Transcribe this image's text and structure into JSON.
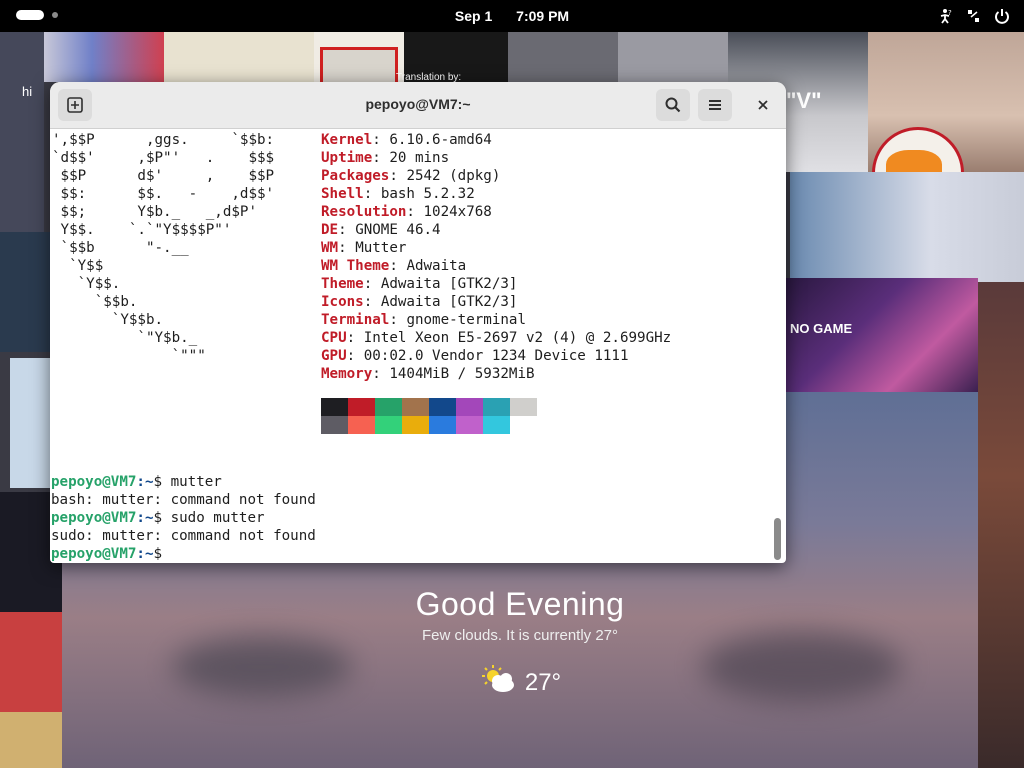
{
  "topbar": {
    "date": "Sep 1",
    "time": "7:09 PM"
  },
  "wallpaper": {
    "tile_texts": [
      "hi",
      "Translation by:",
      "\"V\""
    ]
  },
  "banner": {
    "text": "NO GAME"
  },
  "terminal": {
    "title": "pepoyo@VM7:~",
    "ascii": [
      "',$$P      ,ggs.     `$$b:",
      "`d$$'     ,$P\"'   .    $$$",
      " $$P      d$'     ,    $$P",
      " $$:      $$.   -    ,d$$'",
      " $$;      Y$b._   _,d$P'",
      " Y$$.    `.`\"Y$$$$P\"'",
      " `$$b      \"-.__",
      "  `Y$$",
      "   `Y$$.",
      "     `$$b.",
      "       `Y$$b.",
      "          `\"Y$b._",
      "              `\"\"\""
    ],
    "info": [
      {
        "key": "Kernel",
        "value": "6.10.6-amd64"
      },
      {
        "key": "Uptime",
        "value": "20 mins"
      },
      {
        "key": "Packages",
        "value": "2542 (dpkg)"
      },
      {
        "key": "Shell",
        "value": "bash 5.2.32"
      },
      {
        "key": "Resolution",
        "value": "1024x768"
      },
      {
        "key": "DE",
        "value": "GNOME 46.4"
      },
      {
        "key": "WM",
        "value": "Mutter"
      },
      {
        "key": "WM Theme",
        "value": "Adwaita"
      },
      {
        "key": "Theme",
        "value": "Adwaita [GTK2/3]"
      },
      {
        "key": "Icons",
        "value": "Adwaita [GTK2/3]"
      },
      {
        "key": "Terminal",
        "value": "gnome-terminal"
      },
      {
        "key": "CPU",
        "value": "Intel Xeon E5-2697 v2 (4) @ 2.699GHz"
      },
      {
        "key": "GPU",
        "value": "00:02.0 Vendor 1234 Device 1111"
      },
      {
        "key": "Memory",
        "value": "1404MiB / 5932MiB"
      }
    ],
    "palette_row1": [
      "#1e1e22",
      "#c01c28",
      "#26a269",
      "#a2734c",
      "#12488b",
      "#a347ba",
      "#2aa1b3",
      "#d0cfcc"
    ],
    "palette_row2": [
      "#5e5c64",
      "#f66151",
      "#33d17a",
      "#e9ad0c",
      "#2a7bde",
      "#c061cb",
      "#33c7de"
    ],
    "prompt_user": "pepoyo@VM7",
    "prompt_path": ":~",
    "prompt_symbol": "$",
    "session": [
      {
        "type": "cmd",
        "text": " mutter"
      },
      {
        "type": "out",
        "text": "bash: mutter: command not found"
      },
      {
        "type": "cmd",
        "text": " sudo mutter"
      },
      {
        "type": "out",
        "text": "sudo: mutter: command not found"
      },
      {
        "type": "cmd",
        "text": ""
      }
    ]
  },
  "weather": {
    "greeting": "Good Evening",
    "description": "Few clouds. It is currently 27°",
    "temperature": "27°"
  }
}
